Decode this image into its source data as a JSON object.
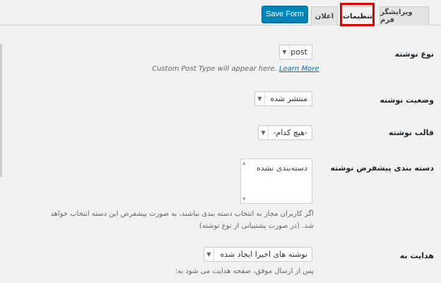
{
  "tabs": {
    "form_editor": "ویرایشگر فرم",
    "settings": "تنظیمات",
    "notices": "اعلان"
  },
  "toolbar": {
    "save_label": "Save Form"
  },
  "fields": {
    "post_type": {
      "label": "نوع نوشته",
      "value": "post",
      "hint": "Custom Post Type will appear here.",
      "hint_link": "Learn More"
    },
    "post_status": {
      "label": "وضعیت نوشته",
      "value": "منتشر شده"
    },
    "post_format": {
      "label": "قالب نوشته",
      "value": "-هیچ کدام-"
    },
    "default_category": {
      "label": "دسته بندی پیشفرض نوشته",
      "value": "دسته‌بندی نشده",
      "hint_line1": "اگر کاربران مجاز به انتخاب دسته بندی نباشند، به صورت پیشفرض این دسته انتخاب خواهد",
      "hint_line2": "شد. (در صورت پشتیبانی از نوع نوشته)"
    },
    "redirect_to": {
      "label": "هدایت به",
      "value": "نوشته های اخیرا ایجاد شده",
      "hint": "پس از ارسال موفق، صفحه هدایت می شود به:"
    }
  },
  "colors": {
    "accent": "#0085ba",
    "highlight": "#e00000",
    "link": "#0073aa"
  }
}
